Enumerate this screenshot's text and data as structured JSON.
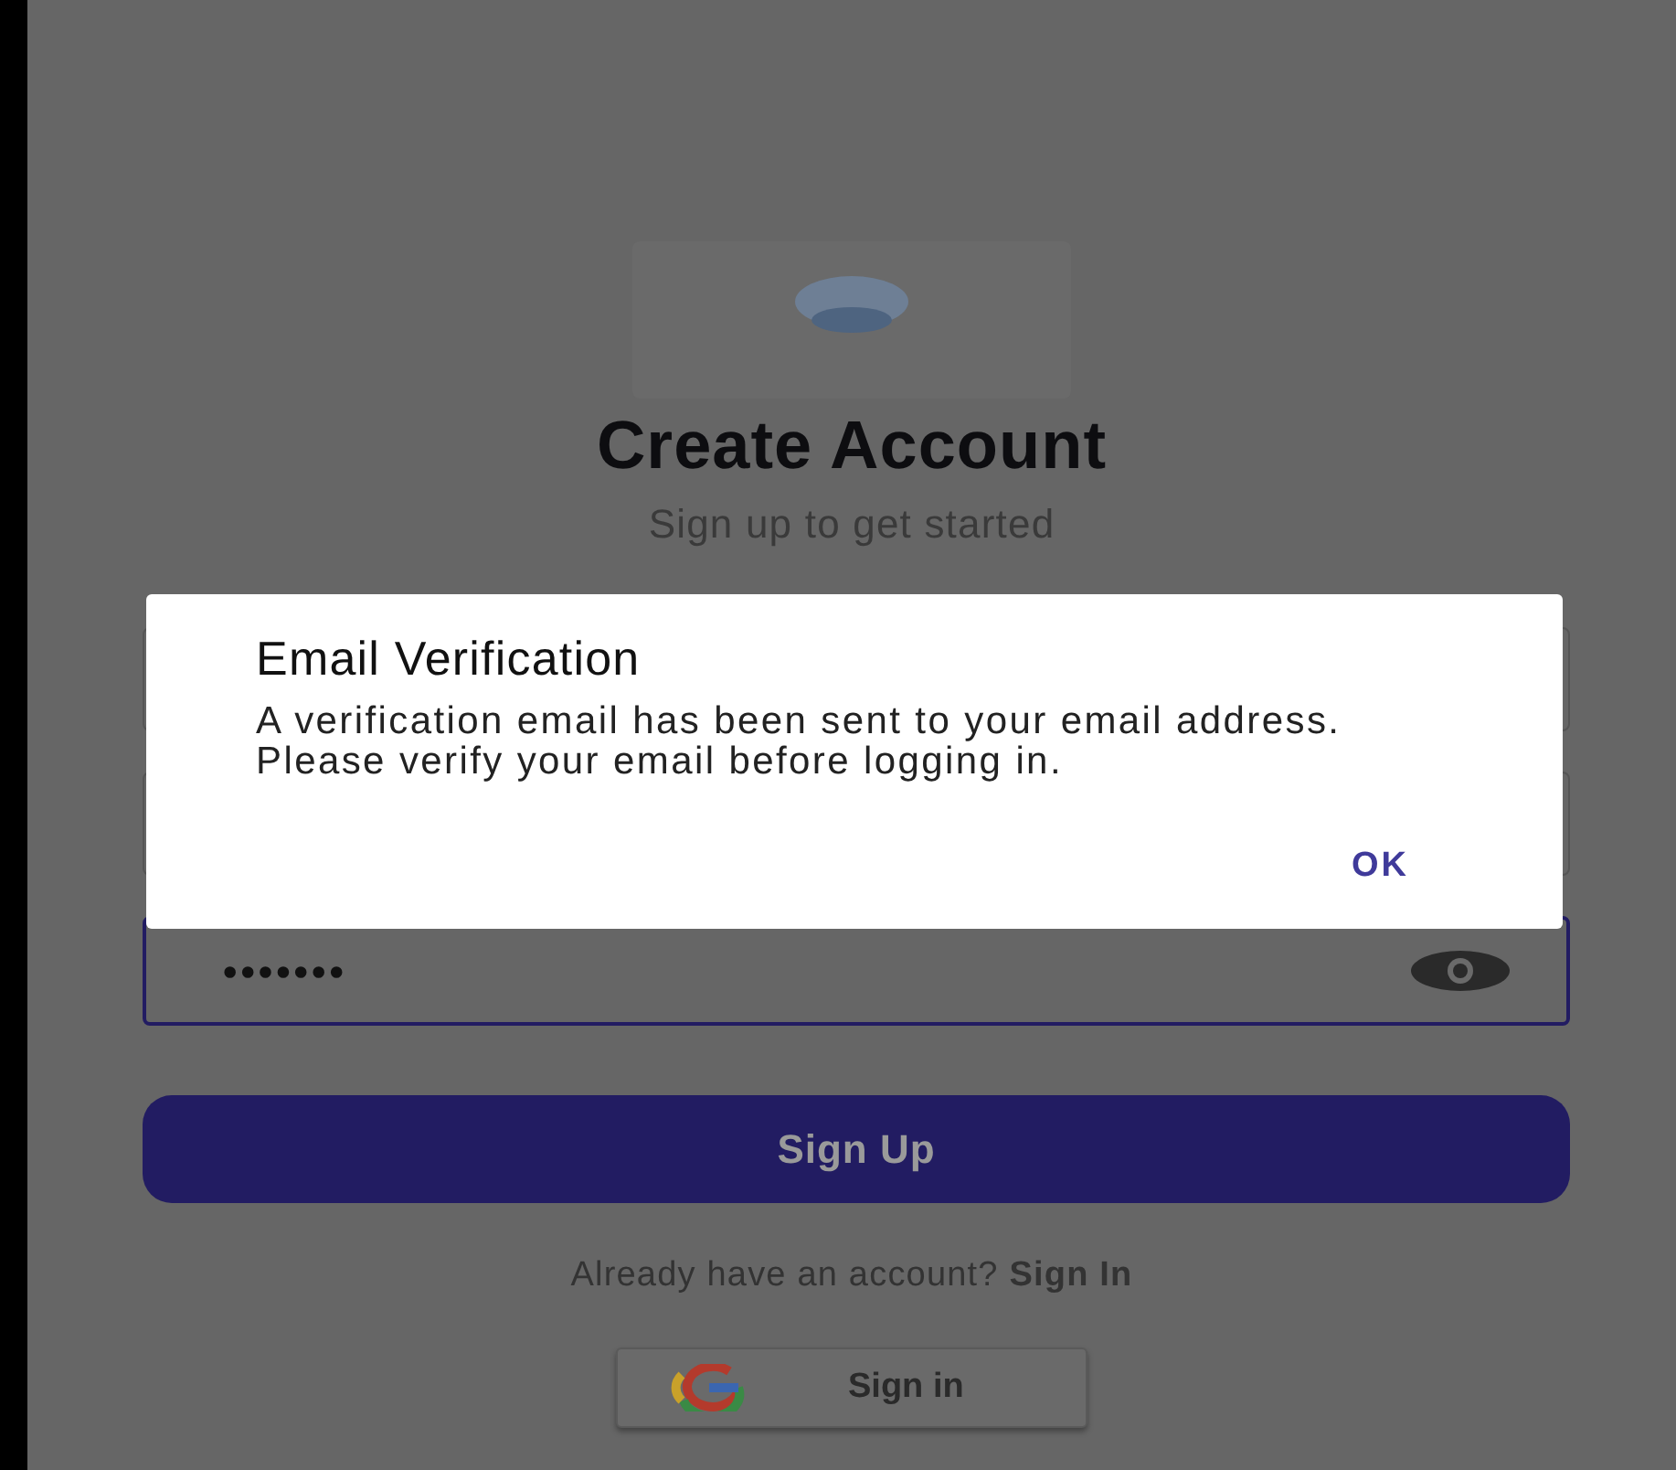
{
  "header": {
    "title": "Create Account",
    "subtitle": "Sign up to get started"
  },
  "fields": [
    {
      "kind": "text"
    },
    {
      "kind": "text"
    },
    {
      "kind": "password",
      "value": "•••••••",
      "focused": true
    }
  ],
  "sign_up_button": "Sign Up",
  "sign_in_prompt": {
    "text": "Already have an account?",
    "link": "Sign In"
  },
  "google_button": "Sign in",
  "dialog": {
    "title": "Email Verification",
    "message": "A verification email has been sent to your email address. Please verify your email before logging in.",
    "button": "OK"
  }
}
